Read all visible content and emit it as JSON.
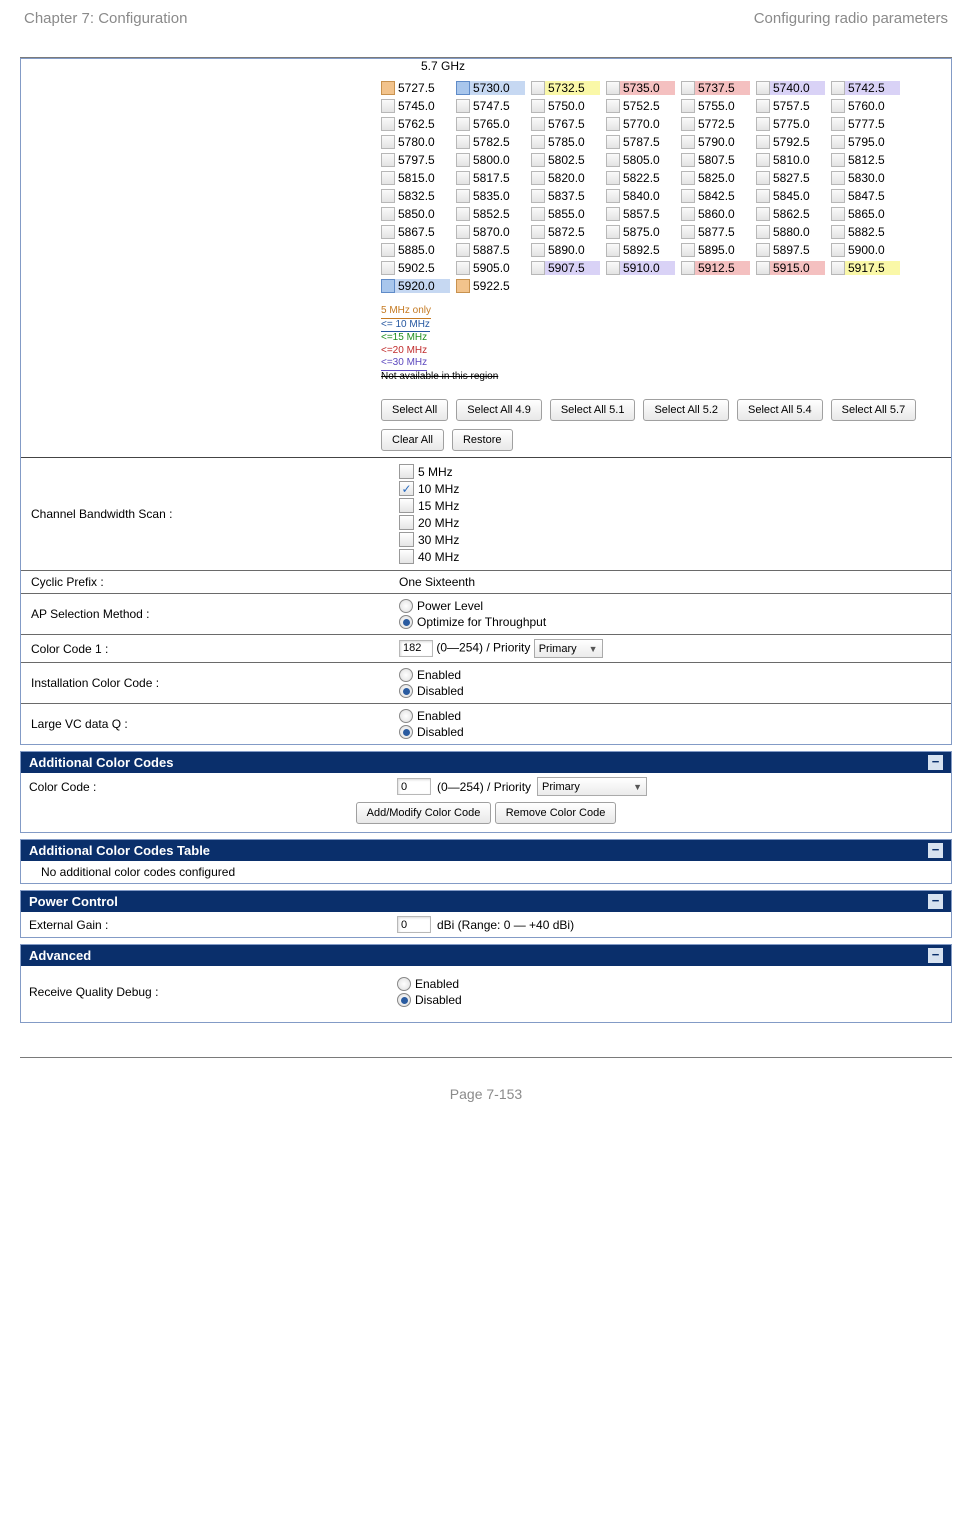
{
  "header": {
    "left": "Chapter 7:  Configuration",
    "right": "Configuring radio parameters"
  },
  "footer": {
    "page": "Page 7-153"
  },
  "freq": {
    "title": "5.7 GHz",
    "rows": [
      [
        {
          "v": "5727.5",
          "cb": "orange"
        },
        {
          "v": "5730.0",
          "cb": "blue",
          "t": "blue"
        },
        {
          "v": "5732.5",
          "cb": "",
          "t": "yellow"
        },
        {
          "v": "5735.0",
          "cb": "",
          "t": "red"
        },
        {
          "v": "5737.5",
          "cb": "",
          "t": "red"
        },
        {
          "v": "5740.0",
          "cb": "",
          "t": "violet"
        },
        {
          "v": "5742.5",
          "cb": "",
          "t": "violet"
        }
      ],
      [
        {
          "v": "5745.0"
        },
        {
          "v": "5747.5"
        },
        {
          "v": "5750.0"
        },
        {
          "v": "5752.5"
        },
        {
          "v": "5755.0"
        },
        {
          "v": "5757.5"
        },
        {
          "v": "5760.0"
        }
      ],
      [
        {
          "v": "5762.5"
        },
        {
          "v": "5765.0"
        },
        {
          "v": "5767.5"
        },
        {
          "v": "5770.0"
        },
        {
          "v": "5772.5"
        },
        {
          "v": "5775.0"
        },
        {
          "v": "5777.5"
        }
      ],
      [
        {
          "v": "5780.0"
        },
        {
          "v": "5782.5"
        },
        {
          "v": "5785.0"
        },
        {
          "v": "5787.5"
        },
        {
          "v": "5790.0"
        },
        {
          "v": "5792.5"
        },
        {
          "v": "5795.0"
        }
      ],
      [
        {
          "v": "5797.5"
        },
        {
          "v": "5800.0"
        },
        {
          "v": "5802.5"
        },
        {
          "v": "5805.0"
        },
        {
          "v": "5807.5"
        },
        {
          "v": "5810.0"
        },
        {
          "v": "5812.5"
        }
      ],
      [
        {
          "v": "5815.0"
        },
        {
          "v": "5817.5"
        },
        {
          "v": "5820.0"
        },
        {
          "v": "5822.5"
        },
        {
          "v": "5825.0"
        },
        {
          "v": "5827.5"
        },
        {
          "v": "5830.0"
        }
      ],
      [
        {
          "v": "5832.5"
        },
        {
          "v": "5835.0"
        },
        {
          "v": "5837.5"
        },
        {
          "v": "5840.0"
        },
        {
          "v": "5842.5"
        },
        {
          "v": "5845.0"
        },
        {
          "v": "5847.5"
        }
      ],
      [
        {
          "v": "5850.0"
        },
        {
          "v": "5852.5"
        },
        {
          "v": "5855.0"
        },
        {
          "v": "5857.5"
        },
        {
          "v": "5860.0"
        },
        {
          "v": "5862.5"
        },
        {
          "v": "5865.0"
        }
      ],
      [
        {
          "v": "5867.5"
        },
        {
          "v": "5870.0"
        },
        {
          "v": "5872.5"
        },
        {
          "v": "5875.0"
        },
        {
          "v": "5877.5"
        },
        {
          "v": "5880.0"
        },
        {
          "v": "5882.5"
        }
      ],
      [
        {
          "v": "5885.0"
        },
        {
          "v": "5887.5"
        },
        {
          "v": "5890.0"
        },
        {
          "v": "5892.5"
        },
        {
          "v": "5895.0"
        },
        {
          "v": "5897.5"
        },
        {
          "v": "5900.0"
        }
      ],
      [
        {
          "v": "5902.5"
        },
        {
          "v": "5905.0"
        },
        {
          "v": "5907.5",
          "cb": "",
          "t": "violet"
        },
        {
          "v": "5910.0",
          "cb": "",
          "t": "violet"
        },
        {
          "v": "5912.5",
          "cb": "",
          "t": "red"
        },
        {
          "v": "5915.0",
          "cb": "",
          "t": "red"
        },
        {
          "v": "5917.5",
          "cb": "",
          "t": "yellow"
        }
      ],
      [
        {
          "v": "5920.0",
          "cb": "blue",
          "t": "blue"
        },
        {
          "v": "5922.5",
          "cb": "orange"
        }
      ]
    ]
  },
  "legend": {
    "l0": "5 MHz only",
    "l1": "<= 10 MHz",
    "l2": "<=15 MHz",
    "l3": "<=20 MHz",
    "l4": "<=30 MHz",
    "l5": "Not available in this region"
  },
  "buttons": {
    "select_all": "Select All",
    "select_49": "Select All 4.9",
    "select_51": "Select All 5.1",
    "select_52": "Select All 5.2",
    "select_54": "Select All 5.4",
    "select_57": "Select All 5.7",
    "clear_all": "Clear All",
    "restore": "Restore"
  },
  "rows": {
    "cbw_label": "Channel Bandwidth Scan :",
    "cbw": [
      "5 MHz",
      "10 MHz",
      "15 MHz",
      "20 MHz",
      "30 MHz",
      "40 MHz"
    ],
    "cbw_checked_index": 1,
    "cyclic_label": "Cyclic Prefix :",
    "cyclic_value": "One Sixteenth",
    "apsel_label": "AP Selection Method :",
    "apsel_opt0": "Power Level",
    "apsel_opt1": "Optimize for Throughput",
    "cc1_label": "Color Code 1 :",
    "cc1_value": "182",
    "cc1_range": "(0—254) / Priority",
    "cc1_priority": "Primary",
    "icc_label": "Installation Color Code :",
    "enabled": "Enabled",
    "disabled": "Disabled",
    "lvc_label": "Large VC data Q :"
  },
  "acc": {
    "bar": "Additional Color Codes",
    "label": "Color Code :",
    "value": "0",
    "range": "(0—254) / Priority",
    "priority": "Primary",
    "btn_add": "Add/Modify Color Code",
    "btn_remove": "Remove Color Code"
  },
  "acct": {
    "bar": "Additional Color Codes Table",
    "empty": "No additional color codes configured"
  },
  "power": {
    "bar": "Power Control",
    "label": "External Gain :",
    "value": "0",
    "suffix": "dBi (Range: 0 — +40 dBi)"
  },
  "adv": {
    "bar": "Advanced",
    "label": "Receive Quality Debug :"
  }
}
